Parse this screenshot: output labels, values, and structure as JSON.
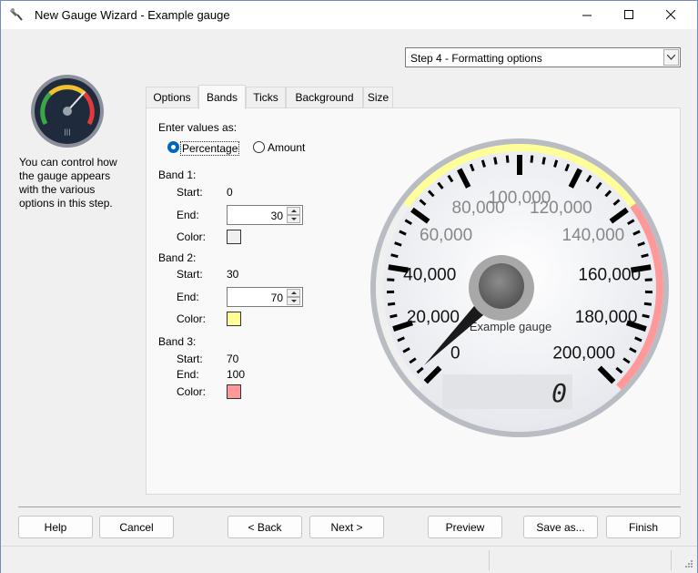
{
  "window": {
    "title": "New Gauge Wizard - Example gauge",
    "controls": {
      "minimize": "—",
      "maximize": "☐",
      "close": "✕"
    }
  },
  "step_select": {
    "value": "Step 4 - Formatting options"
  },
  "help_text": "You can control how\nthe gauge appears\nwith the various\noptions in this step.",
  "tabs": [
    {
      "label": "Options",
      "active": false
    },
    {
      "label": "Bands",
      "active": true
    },
    {
      "label": "Ticks",
      "active": false
    },
    {
      "label": "Background",
      "active": false
    },
    {
      "label": "Size",
      "active": false
    }
  ],
  "bands_panel": {
    "enter_values_label": "Enter values as:",
    "percentage_label": "Percentage",
    "amount_label": "Amount",
    "selected_mode": "Percentage",
    "start_label": "Start:",
    "end_label": "End:",
    "color_label": "Color:",
    "band1": {
      "title": "Band 1:",
      "start": "0",
      "end": "30",
      "color": "#f0f0f0"
    },
    "band2": {
      "title": "Band 2:",
      "start": "30",
      "end": "70",
      "color": "#ffff99"
    },
    "band3": {
      "title": "Band 3:",
      "start": "70",
      "end": "100",
      "color": "#ff9999"
    }
  },
  "gauge_preview": {
    "scale_labels": [
      "0",
      "20,000",
      "40,000",
      "60,000",
      "80,000",
      "100,000",
      "120,000",
      "140,000",
      "160,000",
      "180,000",
      "200,000"
    ],
    "caption": "Example gauge",
    "digital_value": "0",
    "needle_value": 0,
    "band_colors": [
      "#f0f0f0",
      "#ffff99",
      "#ff9999"
    ]
  },
  "buttons": {
    "help": "Help",
    "cancel": "Cancel",
    "back": "< Back",
    "next": "Next >",
    "preview": "Preview",
    "save_as": "Save as...",
    "finish": "Finish"
  }
}
